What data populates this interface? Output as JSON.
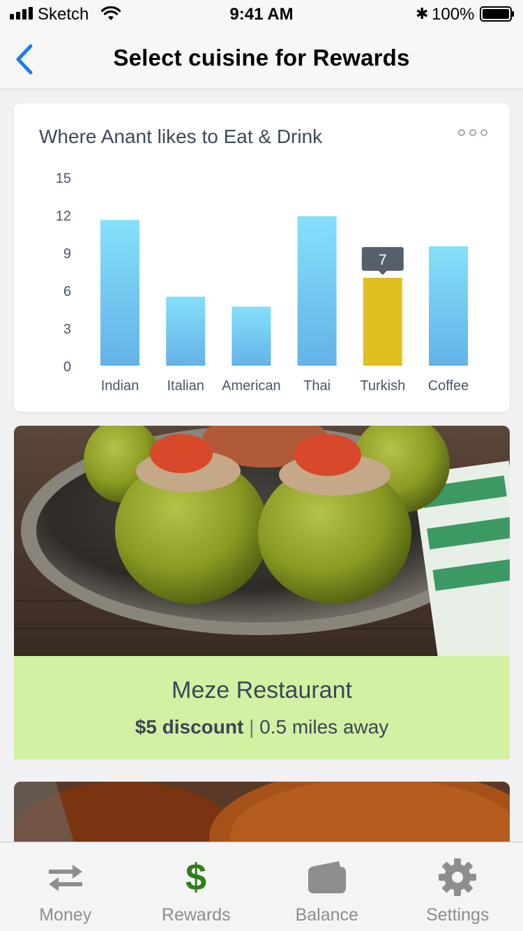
{
  "status_bar": {
    "carrier": "Sketch",
    "time": "9:41 AM",
    "bluetooth": "✱",
    "battery": "100%"
  },
  "nav": {
    "title": "Select cuisine for Rewards",
    "back_icon": "chevron-left-icon"
  },
  "colors": {
    "accent": "#1a7ee6",
    "bar_gradient_top": "#84e0fa",
    "bar_gradient_bottom": "#64b2e8",
    "bar_highlight": "#dfc01e",
    "tooltip": "#55606c",
    "card_green": "#d2f1a2",
    "rewards_green": "#2d7d1a"
  },
  "chart_data": {
    "type": "bar",
    "title": "Where Anant likes to Eat & Drink",
    "categories": [
      "Indian",
      "Italian",
      "American",
      "Thai",
      "Turkish",
      "Coffee"
    ],
    "values": [
      11.6,
      5.5,
      4.7,
      11.9,
      7,
      9.5
    ],
    "ylim": [
      0,
      15
    ],
    "yticks": [
      "15",
      "12",
      "9",
      "6",
      "3",
      "0"
    ],
    "highlight_index": 4,
    "highlight_label": "7",
    "grid": false
  },
  "restaurant": {
    "name": "Meze Restaurant",
    "discount": "$5 discount",
    "separator": "|",
    "distance": "0.5 miles away"
  },
  "tabs": [
    {
      "label": "Money",
      "icon": "transfer-arrows-icon",
      "active": false
    },
    {
      "label": "Rewards",
      "icon": "dollar-icon",
      "active": true
    },
    {
      "label": "Balance",
      "icon": "wallet-icon",
      "active": false
    },
    {
      "label": "Settings",
      "icon": "gear-icon",
      "active": false
    }
  ]
}
